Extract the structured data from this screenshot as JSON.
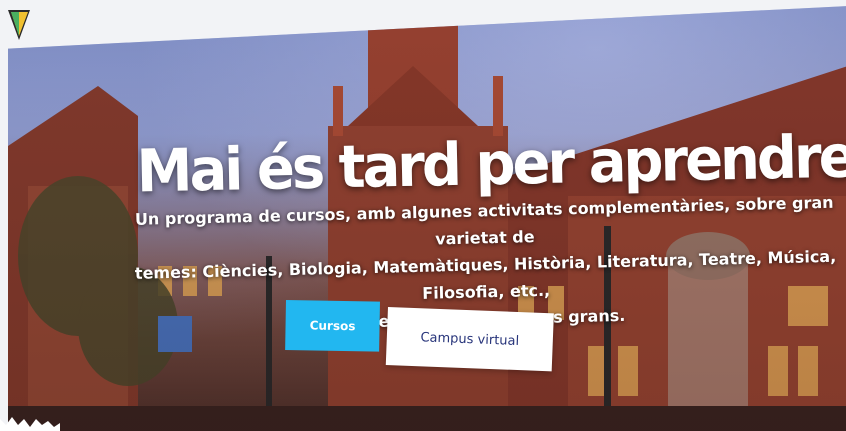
{
  "hero": {
    "title": "Mai és tard per aprendre",
    "description_lines": [
      "Un programa de cursos, amb algunes activitats complementàries, sobre gran varietat de",
      "temes: Ciències, Biologia, Matemàtiques, Història, Literatura, Teatre, Música, Filosofia, etc.,",
      "adreçats a les persones grans."
    ]
  },
  "buttons": {
    "courses_label": "Cursos",
    "campus_label": "Campus virtual"
  },
  "icons": {
    "logo": "triangle-logo-icon"
  },
  "colors": {
    "courses_button": "#22b7f0",
    "campus_button": "#ffffff",
    "campus_text": "#27347a",
    "title_text": "#ffffff"
  }
}
